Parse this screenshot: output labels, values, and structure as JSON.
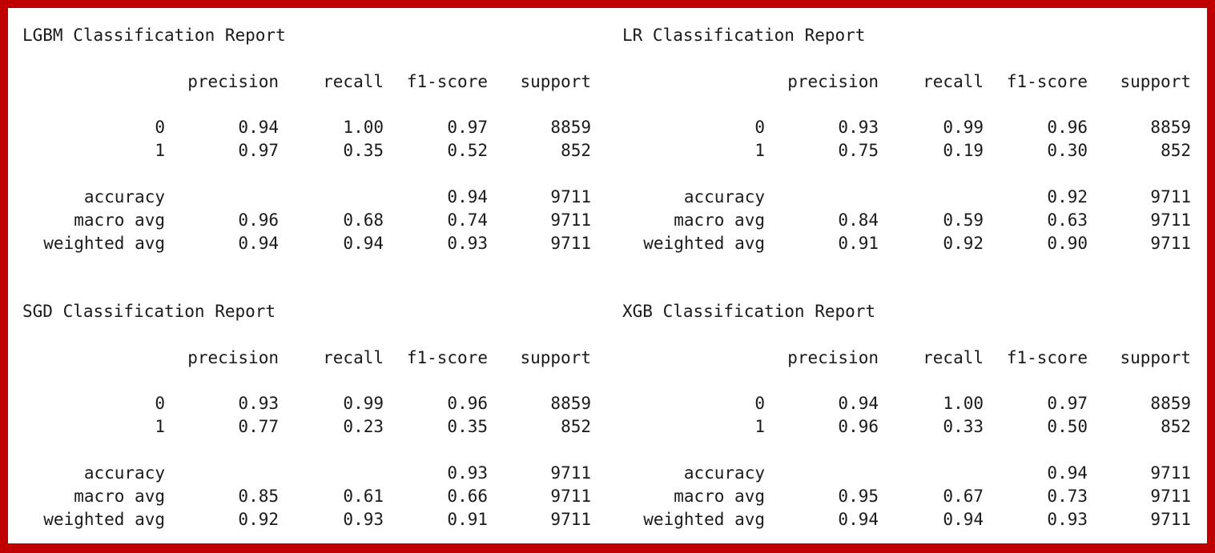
{
  "colors": {
    "frame_border": "#c00000",
    "background": "#ffffff",
    "text": "#1a1a1a"
  },
  "columns": [
    "precision",
    "recall",
    "f1-score",
    "support"
  ],
  "reports": [
    {
      "title": "LGBM Classification Report",
      "rows": [
        {
          "label": "0",
          "precision": "0.94",
          "recall": "1.00",
          "f1": "0.97",
          "support": "8859"
        },
        {
          "label": "1",
          "precision": "0.97",
          "recall": "0.35",
          "f1": "0.52",
          "support": "852"
        },
        {
          "label": "accuracy",
          "precision": "",
          "recall": "",
          "f1": "0.94",
          "support": "9711"
        },
        {
          "label": "macro avg",
          "precision": "0.96",
          "recall": "0.68",
          "f1": "0.74",
          "support": "9711"
        },
        {
          "label": "weighted avg",
          "precision": "0.94",
          "recall": "0.94",
          "f1": "0.93",
          "support": "9711"
        }
      ]
    },
    {
      "title": "LR Classification Report",
      "rows": [
        {
          "label": "0",
          "precision": "0.93",
          "recall": "0.99",
          "f1": "0.96",
          "support": "8859"
        },
        {
          "label": "1",
          "precision": "0.75",
          "recall": "0.19",
          "f1": "0.30",
          "support": "852"
        },
        {
          "label": "accuracy",
          "precision": "",
          "recall": "",
          "f1": "0.92",
          "support": "9711"
        },
        {
          "label": "macro avg",
          "precision": "0.84",
          "recall": "0.59",
          "f1": "0.63",
          "support": "9711"
        },
        {
          "label": "weighted avg",
          "precision": "0.91",
          "recall": "0.92",
          "f1": "0.90",
          "support": "9711"
        }
      ]
    },
    {
      "title": "SGD Classification Report",
      "rows": [
        {
          "label": "0",
          "precision": "0.93",
          "recall": "0.99",
          "f1": "0.96",
          "support": "8859"
        },
        {
          "label": "1",
          "precision": "0.77",
          "recall": "0.23",
          "f1": "0.35",
          "support": "852"
        },
        {
          "label": "accuracy",
          "precision": "",
          "recall": "",
          "f1": "0.93",
          "support": "9711"
        },
        {
          "label": "macro avg",
          "precision": "0.85",
          "recall": "0.61",
          "f1": "0.66",
          "support": "9711"
        },
        {
          "label": "weighted avg",
          "precision": "0.92",
          "recall": "0.93",
          "f1": "0.91",
          "support": "9711"
        }
      ]
    },
    {
      "title": "XGB Classification Report",
      "rows": [
        {
          "label": "0",
          "precision": "0.94",
          "recall": "1.00",
          "f1": "0.97",
          "support": "8859"
        },
        {
          "label": "1",
          "precision": "0.96",
          "recall": "0.33",
          "f1": "0.50",
          "support": "852"
        },
        {
          "label": "accuracy",
          "precision": "",
          "recall": "",
          "f1": "0.94",
          "support": "9711"
        },
        {
          "label": "macro avg",
          "precision": "0.95",
          "recall": "0.67",
          "f1": "0.73",
          "support": "9711"
        },
        {
          "label": "weighted avg",
          "precision": "0.94",
          "recall": "0.94",
          "f1": "0.93",
          "support": "9711"
        }
      ]
    }
  ]
}
